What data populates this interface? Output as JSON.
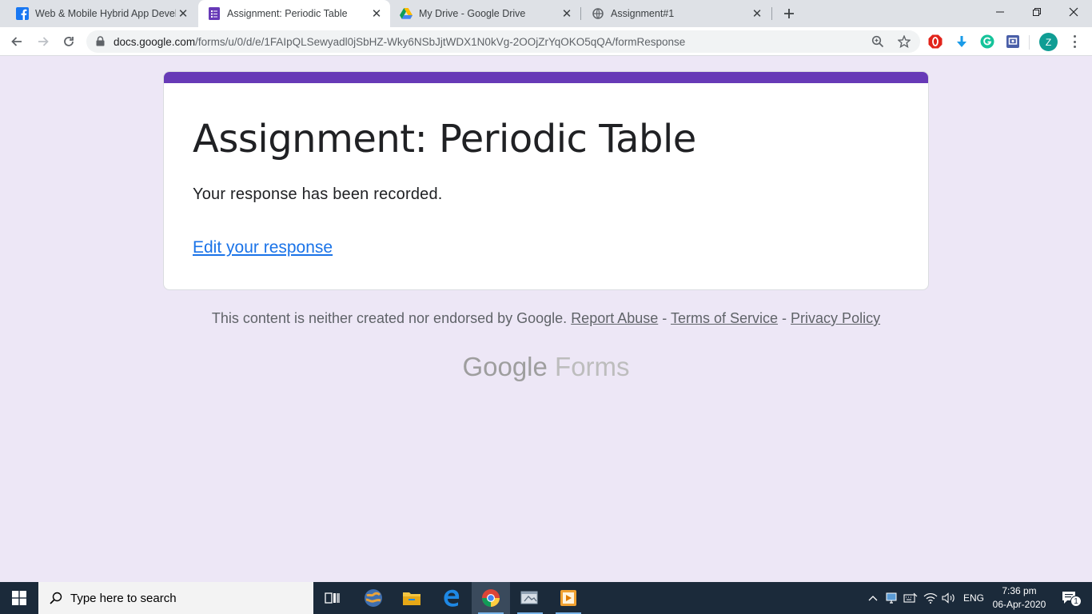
{
  "browser": {
    "tabs": [
      {
        "title": "Web & Mobile Hybrid App Devel",
        "icon": "facebook-icon"
      },
      {
        "title": "Assignment: Periodic Table",
        "icon": "google-forms-icon"
      },
      {
        "title": "My Drive - Google Drive",
        "icon": "google-drive-icon"
      },
      {
        "title": "Assignment#1",
        "icon": "globe-icon"
      }
    ],
    "address": {
      "host": "docs.google.com",
      "path": "/forms/u/0/d/e/1FAIpQLSewyadl0jSbHZ-Wky6NSbJjtWDX1N0kVg-2OOjZrYqOKO5qQA/formResponse"
    },
    "profile_initial": "Z"
  },
  "form": {
    "title": "Assignment: Periodic Table",
    "message": "Your response has been recorded.",
    "edit_link": "Edit your response",
    "accent_color": "#673ab7"
  },
  "footer": {
    "disclaimer": "This content is neither created nor endorsed by Google.",
    "report_abuse": "Report Abuse",
    "separator": "-",
    "terms": "Terms of Service",
    "privacy": "Privacy Policy",
    "brand_google": "Google",
    "brand_forms": "Forms"
  },
  "taskbar": {
    "search_placeholder": "Type here to search",
    "language": "ENG",
    "time": "7:36 pm",
    "date": "06-Apr-2020",
    "notification_count": "1"
  }
}
